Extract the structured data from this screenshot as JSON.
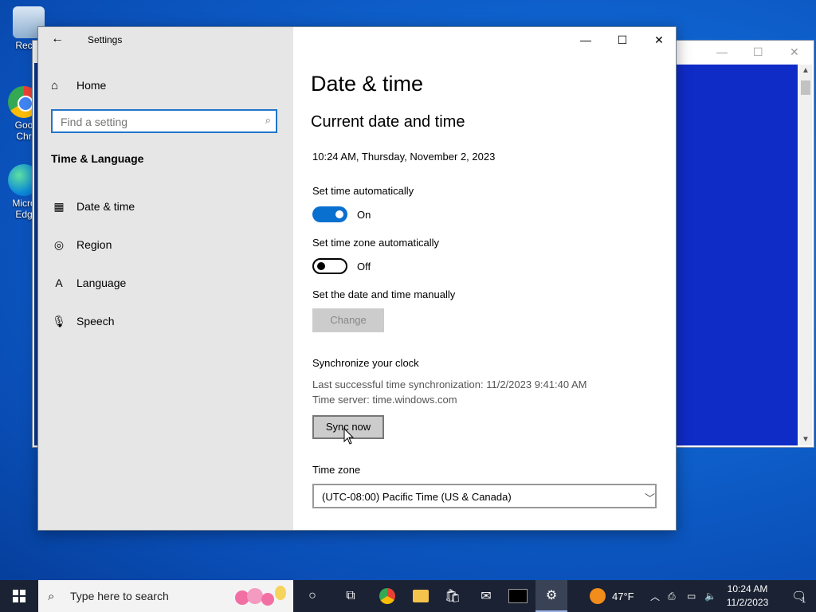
{
  "desktop": {
    "icons": [
      {
        "label": "Recycle Bin",
        "short": "Recyc",
        "icon": "recycle-bin-icon"
      },
      {
        "label": "Google Chrome",
        "short1": "Goo",
        "short2": "Chr",
        "icon": "chrome-icon"
      },
      {
        "label": "Microsoft Edge",
        "short1": "Micro",
        "short2": "Edg",
        "icon": "edge-icon"
      }
    ]
  },
  "window": {
    "title": "Settings",
    "controls": {
      "minimize": "—",
      "maximize": "☐",
      "close": "✕"
    }
  },
  "sidebar": {
    "home_label": "Home",
    "search_placeholder": "Find a setting",
    "section_title": "Time & Language",
    "items": [
      {
        "label": "Date & time",
        "icon": "calendar-clock-icon"
      },
      {
        "label": "Region",
        "icon": "globe-icon"
      },
      {
        "label": "Language",
        "icon": "language-icon"
      },
      {
        "label": "Speech",
        "icon": "microphone-icon"
      }
    ]
  },
  "main": {
    "page_title": "Date & time",
    "section_title": "Current date and time",
    "current_datetime": "10:24 AM, Thursday, November 2, 2023",
    "set_time_auto": {
      "label": "Set time automatically",
      "state": "On"
    },
    "set_timezone_auto": {
      "label": "Set time zone automatically",
      "state": "Off"
    },
    "manual": {
      "label": "Set the date and time manually",
      "button": "Change"
    },
    "sync": {
      "title": "Synchronize your clock",
      "last_sync": "Last successful time synchronization: 11/2/2023 9:41:40 AM",
      "server": "Time server: time.windows.com",
      "button": "Sync now"
    },
    "timezone": {
      "label": "Time zone",
      "value": "(UTC-08:00) Pacific Time (US & Canada)"
    }
  },
  "taskbar": {
    "search_label": "Type here to search",
    "weather": "47°F",
    "time": "10:24 AM",
    "date": "11/2/2023",
    "notification_count": "1"
  }
}
